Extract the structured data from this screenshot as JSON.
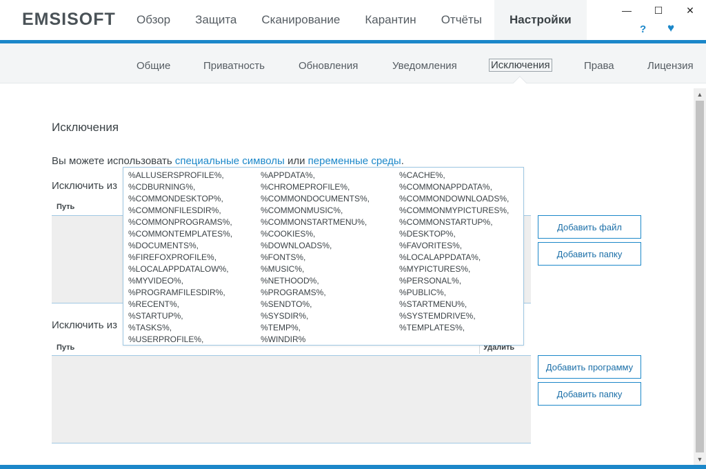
{
  "app": {
    "logo": "EMSISOFT"
  },
  "mainnav": [
    "Обзор",
    "Защита",
    "Сканирование",
    "Карантин",
    "Отчёты",
    "Настройки"
  ],
  "window": {
    "minimize": "—",
    "maximize": "☐",
    "close": "✕",
    "help": "?",
    "heart": "♥"
  },
  "subnav": [
    "Общие",
    "Приватность",
    "Обновления",
    "Уведомления",
    "Исключения",
    "Права",
    "Лицензия"
  ],
  "page": {
    "title": "Исключения",
    "desc_prefix": "Вы можете использовать ",
    "desc_link1": "специальные символы",
    "desc_mid": " или ",
    "desc_link2": "переменные среды",
    "desc_suffix": "."
  },
  "section1": {
    "label": "Исключить из",
    "col_path": "Путь",
    "btn_add_file": "Добавить файл",
    "btn_add_folder": "Добавить папку"
  },
  "section2": {
    "label": "Исключить из",
    "col_path": "Путь",
    "col_delete": "Удалить",
    "btn_add_program": "Добавить программу",
    "btn_add_folder": "Добавить папку"
  },
  "popup": {
    "col1": [
      "%ALLUSERSPROFILE%,",
      "%CDBURNING%,",
      "%COMMONDESKTOP%,",
      "%COMMONFILESDIR%,",
      "%COMMONPROGRAMS%,",
      "%COMMONTEMPLATES%,",
      "%DOCUMENTS%,",
      "%FIREFOXPROFILE%,",
      "%LOCALAPPDATALOW%,",
      "%MYVIDEO%,",
      "%PROGRAMFILESDIR%,",
      "%RECENT%,",
      "%STARTUP%,",
      "%TASKS%,",
      "%USERPROFILE%,"
    ],
    "col2": [
      "%APPDATA%,",
      "%CHROMEPROFILE%,",
      "%COMMONDOCUMENTS%,",
      "%COMMONMUSIC%,",
      "%COMMONSTARTMENU%,",
      "%COOKIES%,",
      "%DOWNLOADS%,",
      "%FONTS%,",
      "%MUSIC%,",
      "%NETHOOD%,",
      "%PROGRAMS%,",
      "%SENDTO%,",
      "%SYSDIR%,",
      "%TEMP%,",
      "%WINDIR%"
    ],
    "col3": [
      "%CACHE%,",
      "%COMMONAPPDATA%,",
      "%COMMONDOWNLOADS%,",
      "%COMMONMYPICTURES%,",
      "%COMMONSTARTUP%,",
      "%DESKTOP%,",
      "%FAVORITES%,",
      "%LOCALAPPDATA%,",
      "%MYPICTURES%,",
      "%PERSONAL%,",
      "%PUBLIC%,",
      "%STARTMENU%,",
      "%SYSTEMDRIVE%,",
      "%TEMPLATES%,"
    ]
  },
  "colors": {
    "accent": "#1b87c9",
    "subnav_bg": "#f3f5f6",
    "table_bg": "#eeeeee"
  }
}
